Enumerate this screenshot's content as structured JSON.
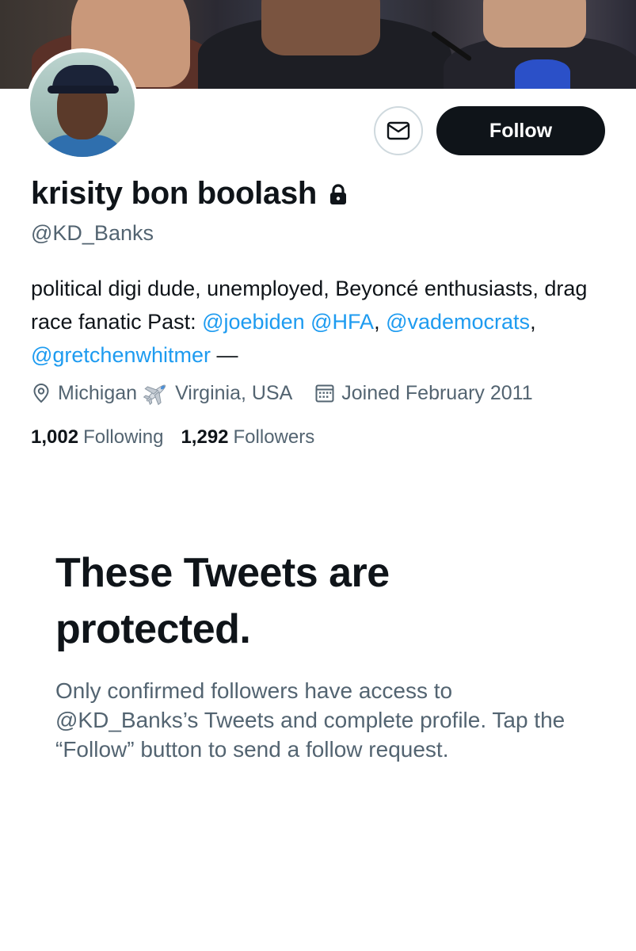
{
  "profile": {
    "display_name": "krisity bon boolash",
    "handle": "@KD_Banks",
    "protected_icon": "lock-icon",
    "bio": {
      "text_1": "political digi dude, unemployed, Beyoncé enthusiasts, drag race fanatic Past: ",
      "link_1": "@joebiden",
      "link_2": "@HFA",
      "sep_1": ", ",
      "link_3": "@vademocrats",
      "sep_2": ", ",
      "link_4": "@gretchenwhitmer",
      "text_end": " —"
    },
    "location_part_1": "Michigan",
    "location_emoji": "airplane-icon",
    "location_part_2": "Virginia, USA",
    "joined": "Joined February 2011"
  },
  "stats": {
    "following_count": "1,002",
    "following_label": "Following",
    "followers_count": "1,292",
    "followers_label": "Followers"
  },
  "actions": {
    "message_icon": "envelope-icon",
    "follow_label": "Follow"
  },
  "protected_notice": {
    "title": "These Tweets are protected.",
    "body": "Only confirmed followers have access to @KD_Banks’s Tweets and complete profile. Tap the “Follow” button to send a follow request."
  },
  "colors": {
    "link": "#1d9bf0",
    "primary_text": "#0f1419",
    "secondary_text": "#536471",
    "follow_button_bg": "#0f1419"
  }
}
